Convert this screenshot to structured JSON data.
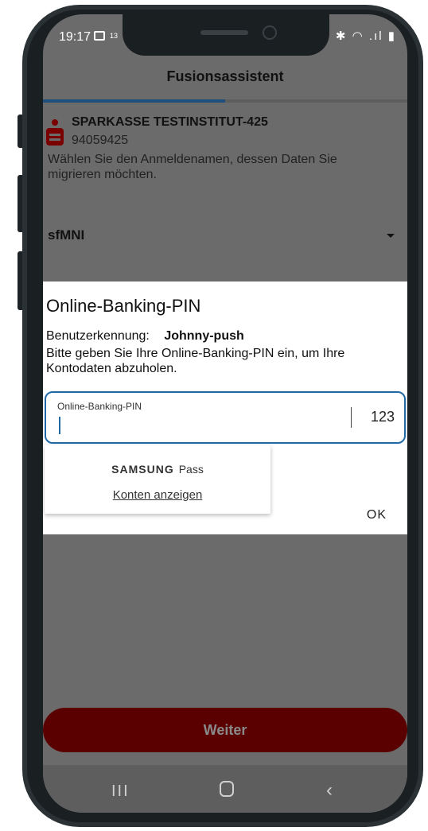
{
  "status_bar": {
    "time": "19:17",
    "notification_count": "13",
    "right_icons": "✱ ◠ .ıl ▮"
  },
  "header": {
    "title": "Fusionsassistent",
    "progress": 0.5
  },
  "bank": {
    "name": "SPARKASSE TESTINSTITUT-425",
    "blz": "94059425",
    "instruction": "Wählen Sie den Anmeldenamen, dessen Daten Sie migrieren möchten."
  },
  "account_select": {
    "value": "sfMNI"
  },
  "dialog": {
    "title": "Online-Banking-PIN",
    "user_label": "Benutzerkennung:",
    "user_value": "Johnny-push",
    "message": "Bitte geben Sie Ihre Online-Banking-PIN ein, um Ihre Kontodaten abzuholen.",
    "pin_label": "Online-Banking-PIN",
    "pin_value": "",
    "keyboard_hint": "123",
    "ok_label": "OK"
  },
  "autofill": {
    "brand": "SAMSUNG",
    "product": "Pass",
    "link": "Konten anzeigen"
  },
  "next_button": {
    "label": "Weiter"
  },
  "navbar": {
    "recent": "III",
    "back": "‹"
  },
  "colors": {
    "brand_red": "#5a0000",
    "focus_blue": "#1f6aa6",
    "progress_blue": "#1e4e7b"
  }
}
